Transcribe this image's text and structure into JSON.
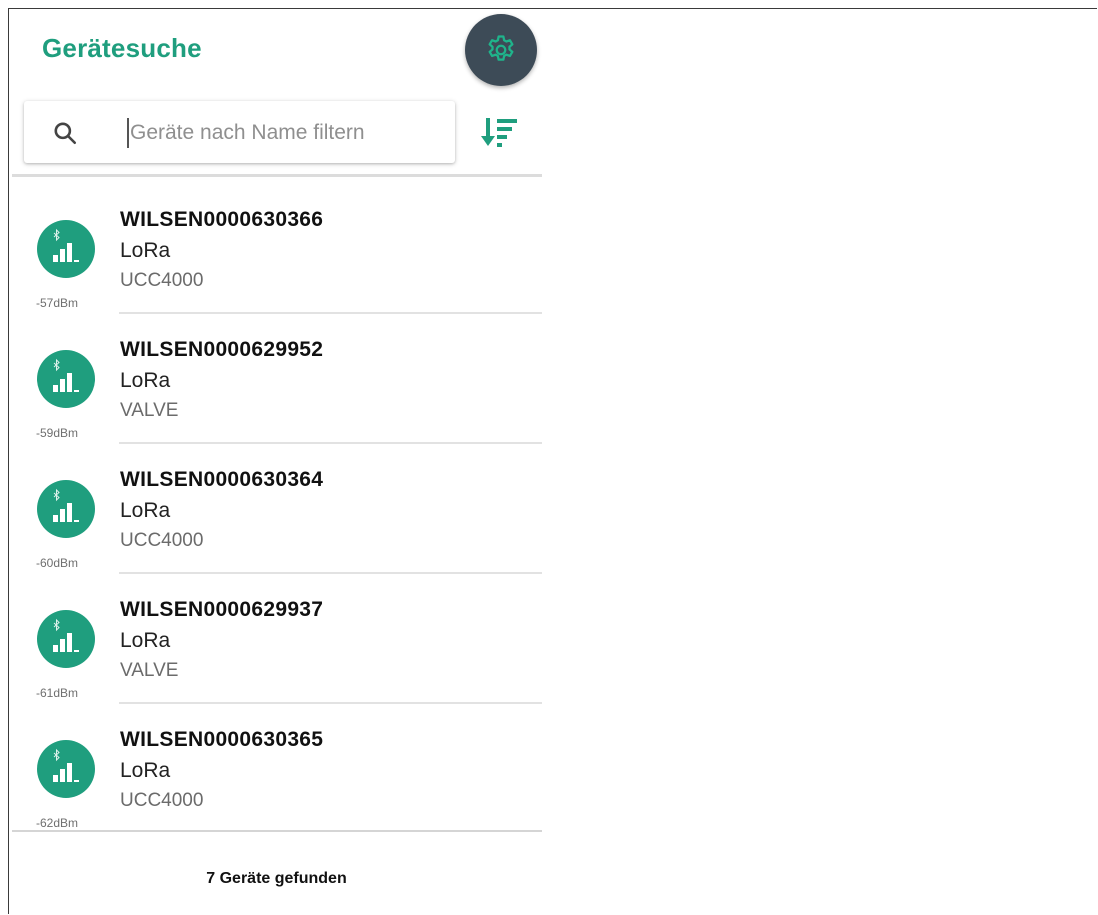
{
  "header": {
    "title": "Gerätesuche",
    "settings_icon": "gear-icon"
  },
  "search": {
    "placeholder": "Geräte nach Name filtern",
    "value": "",
    "search_icon": "search-icon",
    "sort_icon": "sort-descending-icon"
  },
  "devices": [
    {
      "name": "WILSEN0000630366",
      "protocol": "LoRa",
      "type": "UCC4000",
      "rssi": "-57dBm"
    },
    {
      "name": "WILSEN0000629952",
      "protocol": "LoRa",
      "type": "VALVE",
      "rssi": "-59dBm"
    },
    {
      "name": "WILSEN0000630364",
      "protocol": "LoRa",
      "type": "UCC4000",
      "rssi": "-60dBm"
    },
    {
      "name": "WILSEN0000629937",
      "protocol": "LoRa",
      "type": "VALVE",
      "rssi": "-61dBm"
    },
    {
      "name": "WILSEN0000630365",
      "protocol": "LoRa",
      "type": "UCC4000",
      "rssi": "-62dBm"
    }
  ],
  "footer": {
    "status": "7 Geräte gefunden"
  },
  "colors": {
    "accent": "#1f9e7e",
    "settings_bg": "#3d4b57"
  }
}
